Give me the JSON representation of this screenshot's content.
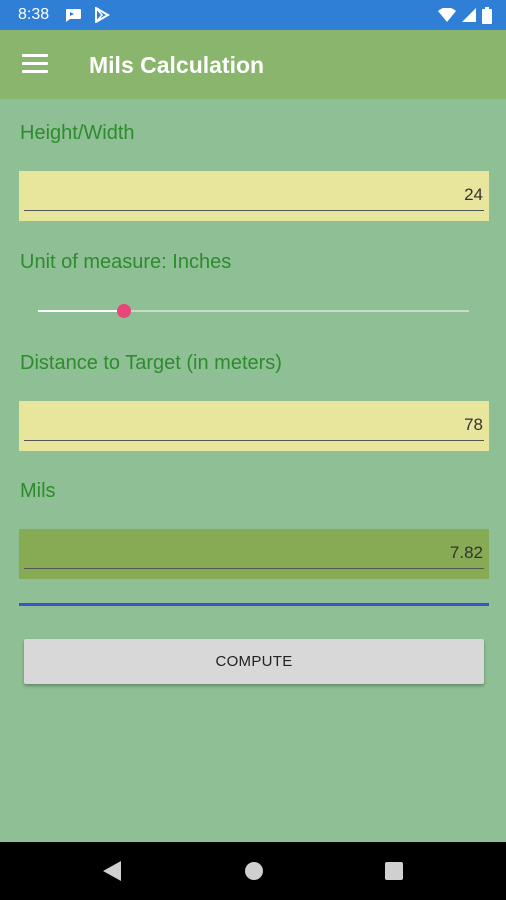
{
  "status_bar": {
    "time": "8:38",
    "icons": [
      "chat-icon",
      "play-store-icon",
      "wifi-icon",
      "signal-icon",
      "battery-icon"
    ]
  },
  "app_bar": {
    "title": "Mils Calculation",
    "menu_icon": "hamburger-menu-icon"
  },
  "form": {
    "height_width": {
      "label": "Height/Width",
      "value": "24"
    },
    "unit_of_measure": {
      "label": "Unit of measure: Inches",
      "slider_value": 0.2
    },
    "distance": {
      "label": "Distance to Target (in meters)",
      "value": "78"
    },
    "mils": {
      "label": "Mils",
      "value": "7.82"
    }
  },
  "compute_button": {
    "label": "COMPUTE"
  },
  "nav_bar": {
    "icons": [
      "back-icon",
      "home-icon",
      "recents-icon"
    ]
  },
  "colors": {
    "background": "#8fbf95",
    "app_bar": "#8ab56c",
    "status_bar": "#2f7fd6",
    "label_text": "#2e8b2e",
    "input_field": "#e8e59c",
    "result_field": "#87aa55",
    "slider_thumb": "#e8457a",
    "divider_line": "#3f51c9"
  }
}
